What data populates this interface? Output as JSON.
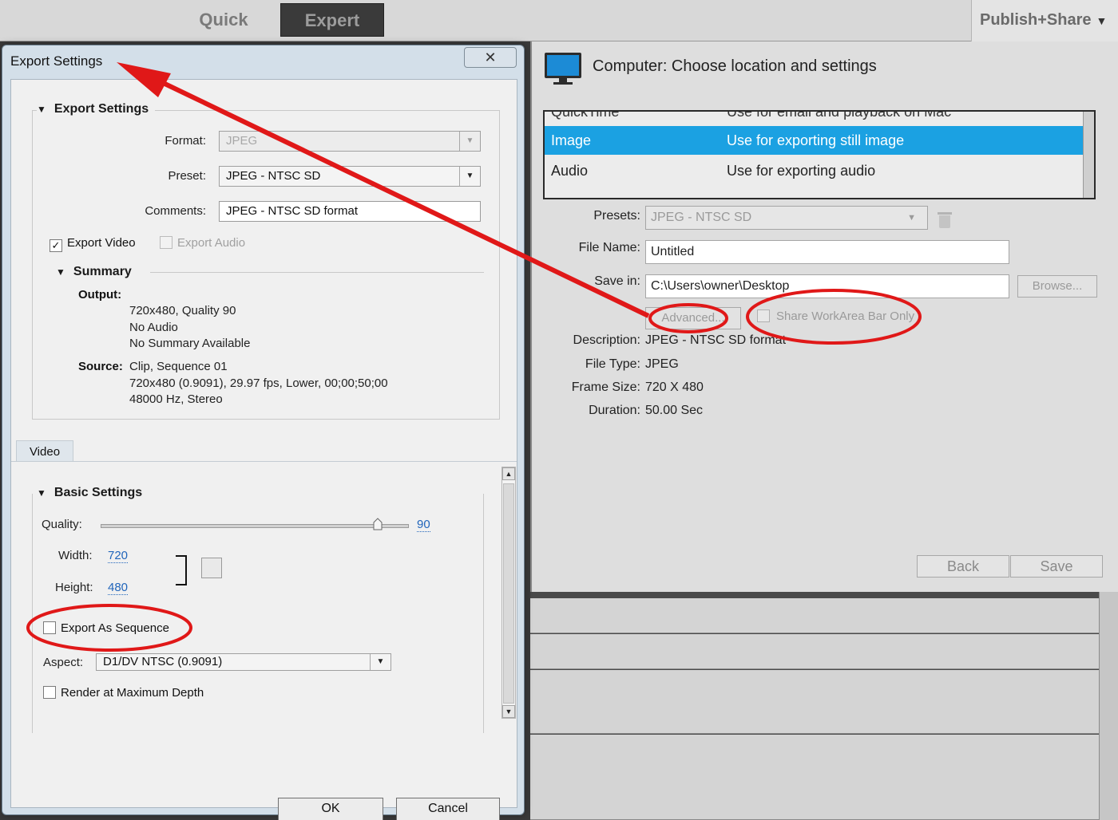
{
  "app_tabs": {
    "quick": "Quick",
    "expert": "Expert",
    "publish_share": "Publish+Share"
  },
  "share_panel": {
    "title": "Computer: Choose location and settings",
    "methods": [
      {
        "name": "QuickTime",
        "description": "Use for email and playback on Mac"
      },
      {
        "name": "Image",
        "description": "Use for exporting  still image",
        "selected": true
      },
      {
        "name": "Audio",
        "description": "Use for exporting audio"
      }
    ],
    "presets_label": "Presets:",
    "presets_value": "JPEG - NTSC SD",
    "file_name_label": "File Name:",
    "file_name_value": "Untitled",
    "save_in_label": "Save in:",
    "save_in_value": "C:\\Users\\owner\\Desktop",
    "browse_label": "Browse...",
    "advanced_label": "Advanced...",
    "share_workarea_label": "Share WorkArea Bar Only",
    "description_label": "Description:",
    "description_value": "JPEG - NTSC SD format",
    "file_type_label": "File Type:",
    "file_type_value": "JPEG",
    "frame_size_label": "Frame Size:",
    "frame_size_value": "720 X 480",
    "duration_label": "Duration:",
    "duration_value": "50.00 Sec",
    "back_label": "Back",
    "save_label": "Save"
  },
  "dialog": {
    "title": "Export Settings",
    "close_glyph": "✕",
    "section_title": "Export Settings",
    "format_label": "Format:",
    "format_value": "JPEG",
    "preset_label": "Preset:",
    "preset_value": "JPEG - NTSC SD",
    "comments_label": "Comments:",
    "comments_value": "JPEG - NTSC SD format",
    "export_video_label": "Export Video",
    "export_video_checked": true,
    "export_audio_label": "Export Audio",
    "export_audio_checked": false,
    "summary_title": "Summary",
    "output_label": "Output:",
    "output_lines": [
      "720x480, Quality 90",
      "No Audio",
      "No Summary Available"
    ],
    "source_label": "Source:",
    "source_lines": [
      "Clip, Sequence 01",
      "720x480 (0.9091), 29.97 fps, Lower, 00;00;50;00",
      "48000 Hz, Stereo"
    ],
    "tab_video": "Video",
    "basic_settings_title": "Basic Settings",
    "quality_label": "Quality:",
    "quality_value": "90",
    "quality_fraction": 0.9,
    "width_label": "Width:",
    "width_value": "720",
    "height_label": "Height:",
    "height_value": "480",
    "export_as_sequence_label": "Export As Sequence",
    "export_as_sequence_checked": false,
    "aspect_label": "Aspect:",
    "aspect_value": "D1/DV NTSC (0.9091)",
    "render_max_depth_label": "Render at Maximum Depth",
    "render_max_depth_checked": false,
    "ok_label": "OK",
    "cancel_label": "Cancel"
  },
  "annotation_color": "#e01818",
  "selection_color": "#1ba1e2"
}
